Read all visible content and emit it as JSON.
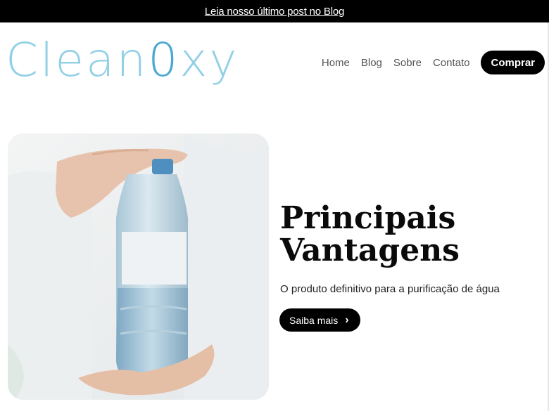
{
  "announcement": {
    "text": "Leia nosso último post no Blog"
  },
  "logo": {
    "part1": "Clean",
    "part2": "0",
    "part3": "xy"
  },
  "nav": {
    "items": [
      "Home",
      "Blog",
      "Sobre",
      "Contato"
    ],
    "cta_label": "Comprar"
  },
  "hero": {
    "title_line1": "Principais",
    "title_line2": "Vantagens",
    "subtitle": "O produto definitivo para a purificação de água",
    "button_label": "Saiba mais",
    "button_icon": "chevron-right-icon"
  },
  "colors": {
    "logo_light": "#92d0e6",
    "logo_dark": "#4aa9d2",
    "accent": "#000000"
  }
}
